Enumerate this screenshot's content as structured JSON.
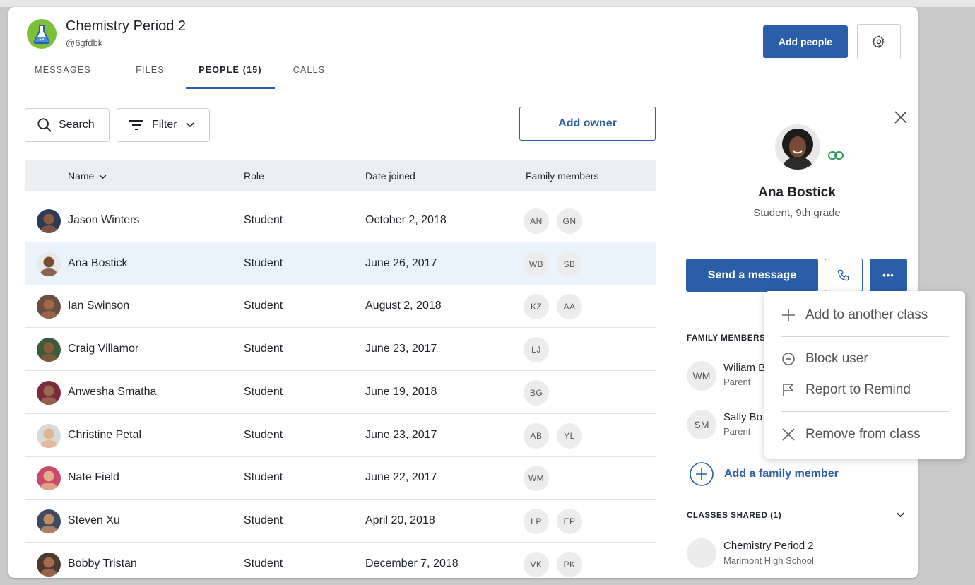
{
  "header": {
    "class_title": "Chemistry Period 2",
    "class_code": "@6gfdbk",
    "add_people_label": "Add people",
    "tabs": [
      {
        "label": "MESSAGES"
      },
      {
        "label": "FILES"
      },
      {
        "label": "PEOPLE (15)"
      },
      {
        "label": "CALLS"
      }
    ],
    "active_tab": "PEOPLE (15)"
  },
  "toolbar": {
    "search_label": "Search",
    "filter_label": "Filter",
    "add_owner_label": "Add owner"
  },
  "table": {
    "columns": [
      "Name",
      "Role",
      "Date joined",
      "Family members"
    ],
    "rows": [
      {
        "name": "Jason Winters",
        "role": "Student",
        "date": "October 2, 2018",
        "family": [
          "AN",
          "GN"
        ]
      },
      {
        "name": "Ana Bostick",
        "role": "Student",
        "date": "June 26, 2017",
        "family": [
          "WB",
          "SB"
        ]
      },
      {
        "name": "Ian Swinson",
        "role": "Student",
        "date": "August 2, 2018",
        "family": [
          "KZ",
          "AA"
        ]
      },
      {
        "name": "Craig Villamor",
        "role": "Student",
        "date": "June 23, 2017",
        "family": [
          "LJ"
        ]
      },
      {
        "name": "Anwesha Smatha",
        "role": "Student",
        "date": "June 19, 2018",
        "family": [
          "BG"
        ]
      },
      {
        "name": "Christine Petal",
        "role": "Student",
        "date": "June 23, 2017",
        "family": [
          "AB",
          "YL"
        ]
      },
      {
        "name": "Nate Field",
        "role": "Student",
        "date": "June 22, 2017",
        "family": [
          "WM"
        ]
      },
      {
        "name": "Steven Xu",
        "role": "Student",
        "date": "April 20, 2018",
        "family": [
          "LP",
          "EP"
        ]
      },
      {
        "name": "Bobby Tristan",
        "role": "Student",
        "date": "December 7, 2018",
        "family": [
          "VK",
          "PK"
        ]
      }
    ],
    "selected_row": "Ana Bostick"
  },
  "profile": {
    "name": "Ana Bostick",
    "subtitle": "Student, 9th grade",
    "send_message_label": "Send a message",
    "more_label": "•••",
    "family_section_label": "FAMILY MEMBERS",
    "family_members": [
      {
        "initials": "WM",
        "name": "Wiliam B",
        "role": "Parent"
      },
      {
        "initials": "SM",
        "name": "Sally Bo",
        "role": "Parent"
      }
    ],
    "add_family_label": "Add a family member",
    "classes_section_label": "CLASSES SHARED (1)",
    "classes": [
      {
        "name": "Chemistry Period 2",
        "school": "Marimont High School"
      }
    ]
  },
  "menu": {
    "items": [
      {
        "label": "Add to another class",
        "icon": "plus-icon"
      },
      {
        "label": "Block user",
        "icon": "block-icon"
      },
      {
        "label": "Report to Remind",
        "icon": "flag-icon"
      },
      {
        "label": "Remove from class",
        "icon": "close-icon"
      }
    ]
  },
  "colors": {
    "brand_blue": "#2a5ea8",
    "link_green": "#2f9a5a",
    "class_avatar_green": "#7cbf3a",
    "selected_row": "#eaf2fb"
  }
}
